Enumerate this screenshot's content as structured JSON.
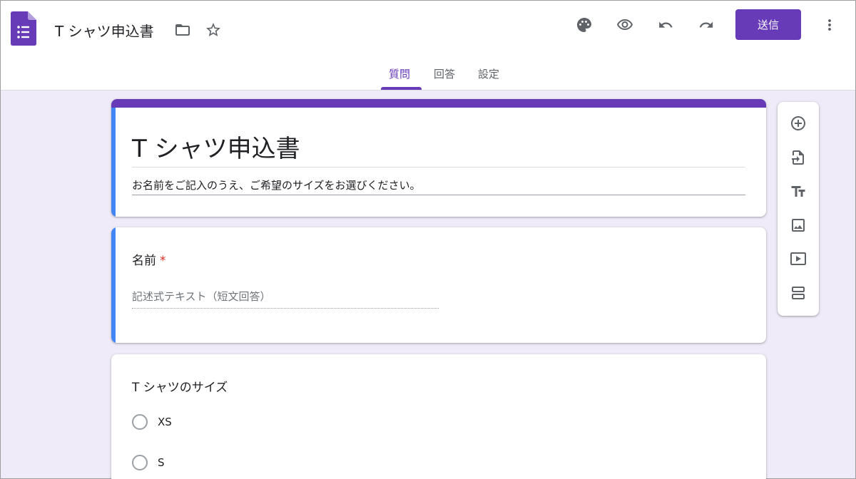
{
  "header": {
    "doc_title": "T シャツ申込書",
    "send_label": "送信",
    "icons": [
      "forms-logo-icon",
      "folder-icon",
      "star-icon",
      "palette-icon",
      "preview-eye-icon",
      "undo-icon",
      "redo-icon",
      "more-vert-icon"
    ],
    "accent_color": "#673ab7"
  },
  "tabs": [
    {
      "label": "質問",
      "active": true
    },
    {
      "label": "回答",
      "active": false
    },
    {
      "label": "設定",
      "active": false
    }
  ],
  "form": {
    "title": "T シャツ申込書",
    "description": "お名前をご記入のうえ、ご希望のサイズをお選びください。"
  },
  "questions": [
    {
      "title": "名前",
      "required_mark": "*",
      "answer_placeholder": "記述式テキスト（短文回答）"
    },
    {
      "title": "T シャツのサイズ",
      "options": [
        "XS",
        "S"
      ]
    }
  ],
  "toolbar": {
    "icons": [
      "add-question-icon",
      "import-questions-icon",
      "add-title-icon",
      "add-image-icon",
      "add-video-icon",
      "add-section-icon"
    ]
  }
}
